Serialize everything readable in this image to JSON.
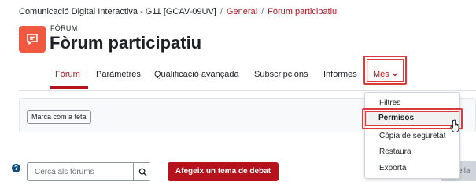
{
  "breadcrumb": {
    "course": "Comunicació Digital Interactiva - G11 [GCAV-09UV]",
    "section": "General",
    "current": "Fòrum participatiu"
  },
  "page": {
    "kicker": "FÒRUM",
    "title": "Fòrum participatiu"
  },
  "nav": {
    "tabs": [
      {
        "label": "Fòrum",
        "active": true
      },
      {
        "label": "Paràmetres"
      },
      {
        "label": "Qualificació avançada"
      },
      {
        "label": "Subscripcions"
      },
      {
        "label": "Informes"
      }
    ],
    "more_label": "Més",
    "more_icon": "chevron-down-icon"
  },
  "actions": {
    "mark_done_label": "Marca com a feta"
  },
  "dropdown": {
    "items": [
      {
        "label": "Filtres"
      },
      {
        "label": "Permisos",
        "highlighted": true
      },
      {
        "label": "Còpia de seguretat"
      },
      {
        "label": "Restaura"
      },
      {
        "label": "Exporta"
      }
    ]
  },
  "search": {
    "placeholder": "Cerca als fòrums",
    "button_icon": "search-icon"
  },
  "buttons": {
    "add_topic": "Afegeix un tema de debat",
    "right_partial": "ella"
  },
  "help": {
    "icon": "help-icon",
    "glyph": "?"
  },
  "colors": {
    "brand": "#b5121b",
    "forum_icon_bg": "#f0593f",
    "annotation": "#d93a3a"
  }
}
